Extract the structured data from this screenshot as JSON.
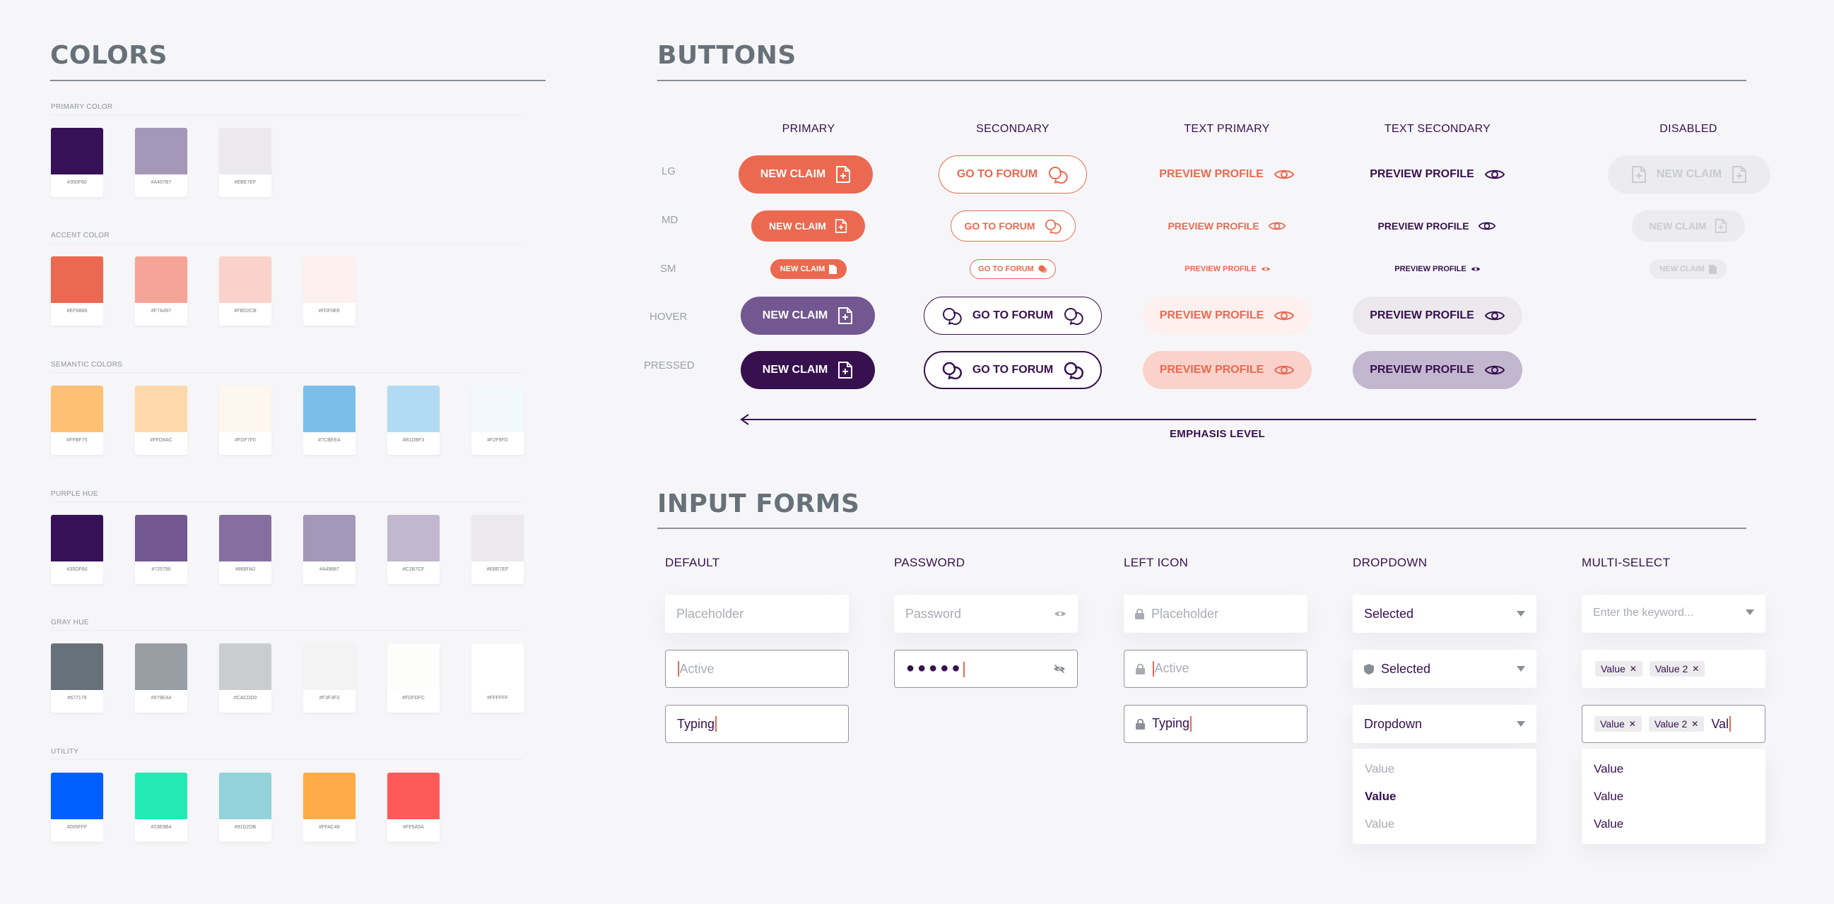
{
  "colors": {
    "title": "COLORS",
    "groups": [
      {
        "label": "PRIMARY COLOR",
        "swatches": [
          {
            "hex": "#350F60"
          },
          {
            "hex": "#A497B7"
          },
          {
            "hex": "#EBE7EF"
          }
        ]
      },
      {
        "label": "ACCENT COLOR",
        "swatches": [
          {
            "hex": "#EF6B86"
          },
          {
            "hex": "#F7A497"
          },
          {
            "hex": "#FBD2CB"
          },
          {
            "hex": "#FDF0EE"
          }
        ]
      },
      {
        "label": "SEMANTIC COLORS",
        "swatches": [
          {
            "hex": "#FFBF75"
          },
          {
            "hex": "#FFD8AC"
          },
          {
            "hex": "#FDF7F0"
          },
          {
            "hex": "#7CBEEA"
          },
          {
            "hex": "#B1DBF3"
          },
          {
            "hex": "#F2F9FD"
          }
        ]
      },
      {
        "label": "PURPLE HUE",
        "swatches": [
          {
            "hex": "#35OF60"
          },
          {
            "hex": "#725790"
          },
          {
            "hex": "#866FA0"
          },
          {
            "hex": "#A49887"
          },
          {
            "hex": "#C2B7CF"
          },
          {
            "hex": "#EBE7EF"
          }
        ]
      },
      {
        "label": "GRAY HUE",
        "swatches": [
          {
            "hex": "#677179"
          },
          {
            "hex": "#979EA4"
          },
          {
            "hex": "#CACDD0"
          },
          {
            "hex": "#F3F3F3"
          },
          {
            "hex": "#FDFDFC"
          },
          {
            "hex": "#FFFFFF"
          }
        ]
      },
      {
        "label": "UTILITY",
        "swatches": [
          {
            "hex": "#005FFF"
          },
          {
            "hex": "#23E9B4"
          },
          {
            "hex": "#91D2DB"
          },
          {
            "hex": "#FFAC48"
          },
          {
            "hex": "#FF5A5A"
          }
        ]
      }
    ],
    "fill_colors": [
      [
        "#361158",
        "#A497B7",
        "#EBE9ED"
      ],
      [
        "#EB6950",
        "#F6A497",
        "#FAD2CB",
        "#FDF0EE"
      ],
      [
        "#FFBF75",
        "#FFD8AC",
        "#FDF7F0",
        "#7CBEEA",
        "#B1DBF3",
        "#F2F9FD"
      ],
      [
        "#361158",
        "#725790",
        "#866FA0",
        "#A497B7",
        "#C2B7CF",
        "#EBE9ED"
      ],
      [
        "#677179",
        "#979EA4",
        "#CACDD0",
        "#F3F3F3",
        "#FDFDFC",
        "#FFFFFF"
      ],
      [
        "#005FFF",
        "#23E9B4",
        "#91D2DB",
        "#FFAC48",
        "#FF5A5A"
      ]
    ]
  },
  "buttons": {
    "title": "BUTTONS",
    "columns": [
      "PRIMARY",
      "SECONDARY",
      "TEXT PRIMARY",
      "TEXT SECONDARY",
      "DISABLED"
    ],
    "rows": [
      "LG",
      "MD",
      "SM",
      "HOVER",
      "PRESSED"
    ],
    "new_claim": "NEW CLAIM",
    "go_to_forum": "GO TO FORUM",
    "preview_profile": "PREVIEW PROFILE",
    "emphasis_label": "EMPHASIS LEVEL",
    "palette": {
      "accent": "#EB6950",
      "primary": "#37104F",
      "hover": "#725790",
      "text_hover_bg": "#FDF0EE",
      "text_pressed_bg": "#FAD2CB",
      "sec_hover_bg": "#EBE9ED",
      "sec_pressed_bg": "#C2B7CF",
      "disabled_bg": "#ECECEE"
    }
  },
  "forms": {
    "title": "INPUT FORMS",
    "default": {
      "label": "DEFAULT",
      "placeholder": "Placeholder",
      "active": "Active",
      "typing": "Typing"
    },
    "password": {
      "label": "PASSWORD",
      "placeholder": "Password",
      "dots": "●●●●●"
    },
    "left_icon": {
      "label": "LEFT ICON",
      "placeholder": "Placeholder",
      "active": "Active",
      "typing": "Typing"
    },
    "dropdown": {
      "label": "DROPDOWN",
      "selected1": "Selected",
      "selected2": "Selected",
      "dropdown": "Dropdown",
      "options": [
        "Value",
        "Value",
        "Value"
      ]
    },
    "multiselect": {
      "label": "MULTI-SELECT",
      "placeholder": "Enter the keyword...",
      "chip1": "Value",
      "chip2": "Value 2",
      "typing": "Val",
      "options": [
        "Value",
        "Value",
        "Value"
      ]
    }
  }
}
